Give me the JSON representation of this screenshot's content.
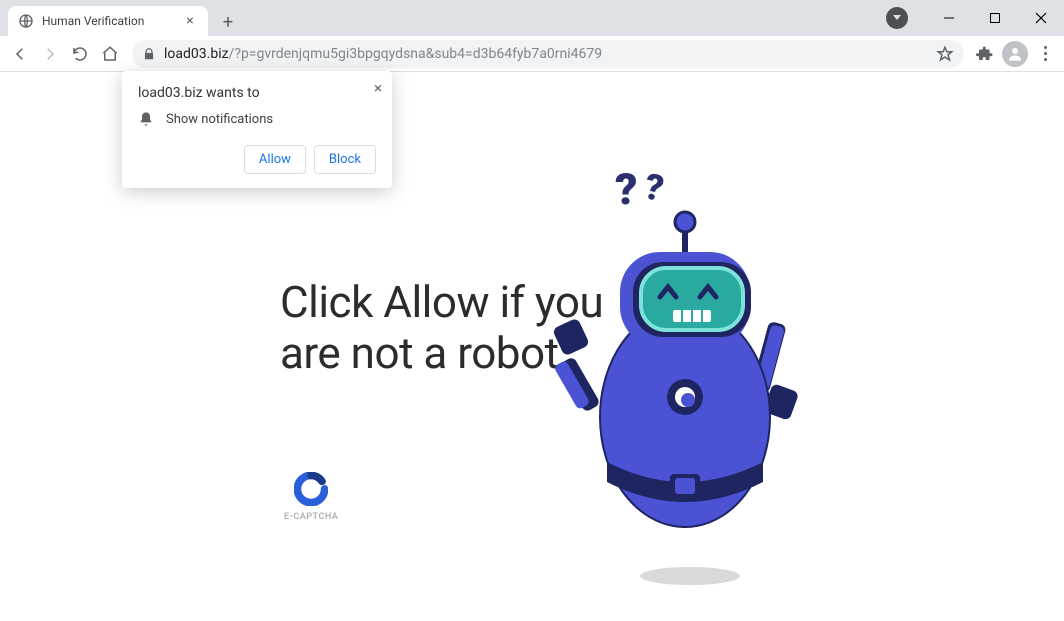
{
  "tab": {
    "title": "Human Verification"
  },
  "toolbar": {
    "url_host": "load03.biz",
    "url_rest": "/?p=gvrdenjqmu5gi3bpgqydsna&sub4=d3b64fyb7a0rni4679"
  },
  "permission": {
    "title": "load03.biz wants to",
    "request": "Show notifications",
    "allow": "Allow",
    "block": "Block"
  },
  "page": {
    "headline": "Click Allow if you are not a robot",
    "captcha": "E-CAPTCHA",
    "qmarks": "??"
  }
}
